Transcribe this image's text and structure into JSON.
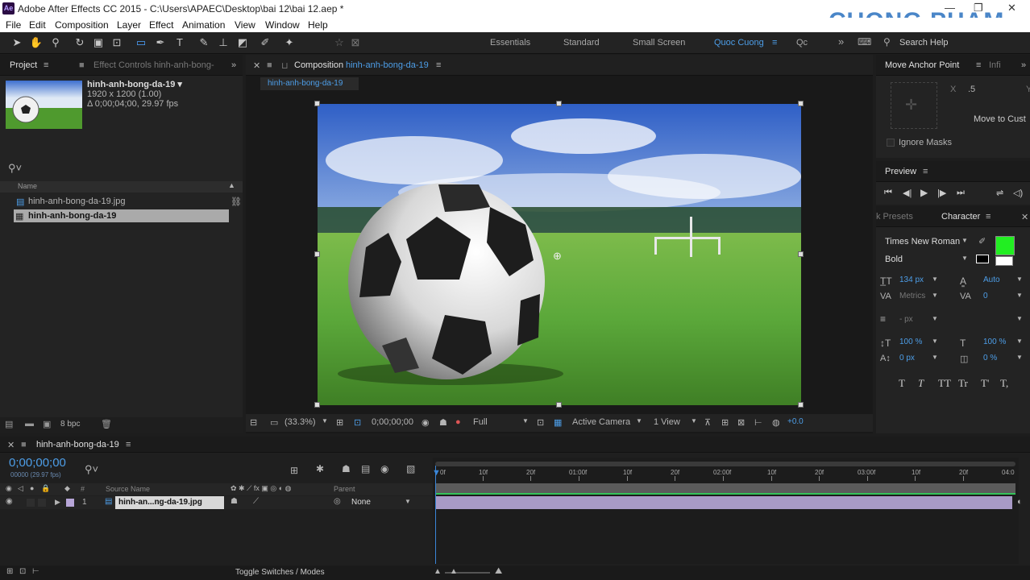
{
  "app": {
    "title": "Adobe After Effects CC 2015 - C:\\Users\\APAEC\\Desktop\\bai 12\\bai 12.aep *",
    "icon": "Ae",
    "watermark": "CUONG PHAM"
  },
  "menu": [
    "File",
    "Edit",
    "Composition",
    "Layer",
    "Effect",
    "Animation",
    "View",
    "Window",
    "Help"
  ],
  "workspaces": {
    "items": [
      "Essentials",
      "Standard",
      "Small Screen",
      "Quoc Cuong",
      "Qc"
    ],
    "active": "Quoc Cuong",
    "search": "Search Help"
  },
  "project": {
    "tab_label": "Project",
    "effect_controls_tab": "Effect Controls hinh-anh-bong-",
    "comp_name": "hinh-anh-bong-da-19 ▾",
    "comp_size": "1920 x 1200 (1.00)",
    "comp_duration": "Δ 0;00;04;00, 29.97 fps",
    "column_name": "Name",
    "items": [
      "hinh-anh-bong-da-19.jpg",
      "hinh-anh-bong-da-19"
    ],
    "bpc": "8 bpc"
  },
  "composition": {
    "tab_prefix": "Composition",
    "tab_name": "hinh-anh-bong-da-19",
    "flow_tab": "hinh-anh-bong-da-19",
    "zoom": "(33.3%)",
    "timecode": "0;00;00;00",
    "resolution": "Full",
    "camera": "Active Camera",
    "views": "1 View",
    "exposure": "+0.0"
  },
  "anchor": {
    "title": "Move Anchor Point",
    "info_tab": "Infi",
    "x_label": "X",
    "x_value": ".5",
    "y_label": "Y",
    "move_btn": "Move to Cust",
    "ignore_masks": "Ignore Masks"
  },
  "preview": {
    "title": "Preview"
  },
  "character": {
    "presets_tab": "k Presets",
    "title": "Character",
    "font": "Times New Roman",
    "style": "Bold",
    "size": "134 px",
    "leading": "Auto",
    "kerning": "Metrics",
    "tracking": "0",
    "stroke": "- px",
    "vscale": "100 %",
    "hscale": "100 %",
    "baseline": "0 px",
    "tsume": "0 %",
    "fill_color": "#22ee22",
    "caps": [
      "T",
      "T",
      "TT",
      "Tr",
      "T'",
      "T,"
    ]
  },
  "timeline": {
    "tab_name": "hinh-anh-bong-da-19",
    "timecode": "0;00;00;00",
    "frame_info": "00000 (29.97 fps)",
    "col_hash": "#",
    "col_source": "Source Name",
    "col_parent": "Parent",
    "layer_num": "1",
    "layer_name": "hinh-an...ng-da-19.jpg",
    "layer_parent": "None",
    "ticks": [
      "0f",
      "10f",
      "20f",
      "01:00f",
      "10f",
      "20f",
      "02:00f",
      "10f",
      "20f",
      "03:00f",
      "10f",
      "20f",
      "04:0"
    ],
    "toggle": "Toggle Switches / Modes"
  }
}
